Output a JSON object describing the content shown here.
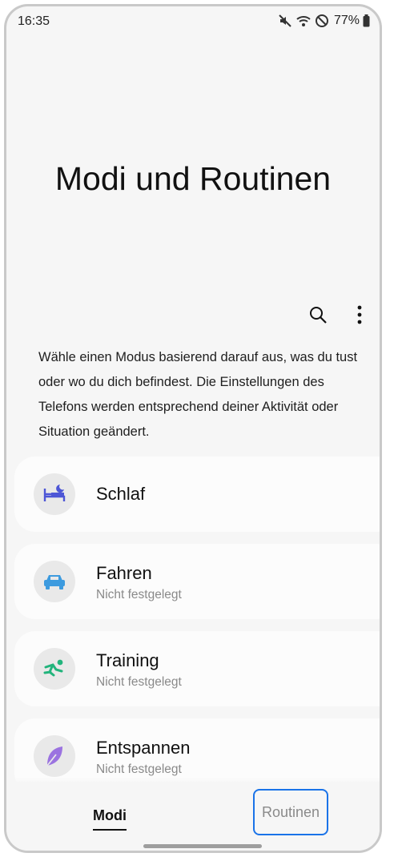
{
  "status": {
    "time": "16:35",
    "battery": "77%"
  },
  "page": {
    "title": "Modi und Routinen"
  },
  "description": "Wähle einen Modus basierend darauf aus, was du tust oder wo du dich befindest. Die Einstellungen des Telefons werden entsprechend deiner Aktivität oder Situation geändert.",
  "modes": [
    {
      "name": "Schlaf",
      "status": "",
      "icon": "sleep-bed-icon",
      "color": "#4d56d6"
    },
    {
      "name": "Fahren",
      "status": "Nicht festgelegt",
      "icon": "car-icon",
      "color": "#3d9bdf"
    },
    {
      "name": "Training",
      "status": "Nicht festgelegt",
      "icon": "running-person-icon",
      "color": "#22b47c"
    },
    {
      "name": "Entspannen",
      "status": "Nicht festgelegt",
      "icon": "leaf-icon",
      "color": "#9b73e0"
    }
  ],
  "nav": {
    "tab_modes": "Modi",
    "tab_routines": "Routinen"
  },
  "colors": {
    "focus_outline": "#1a73e8",
    "background": "#f6f6f6"
  }
}
